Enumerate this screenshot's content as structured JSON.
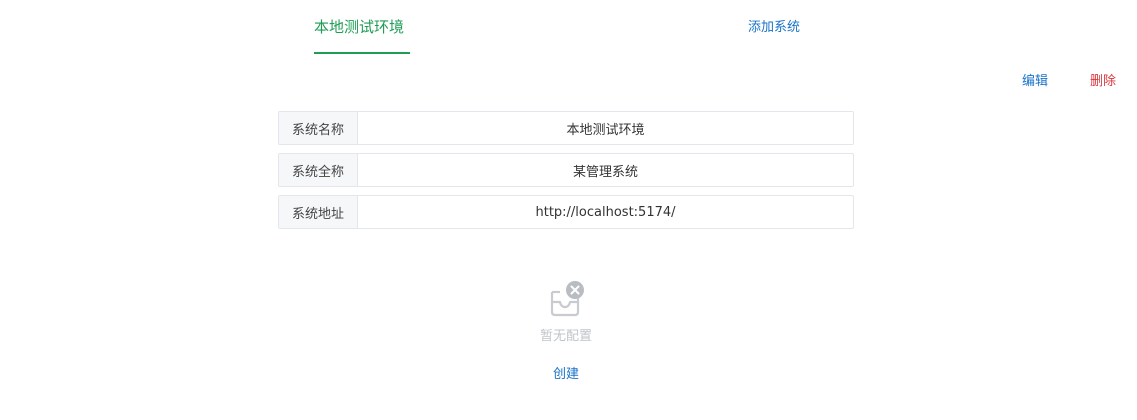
{
  "tabs": {
    "active_label": "本地测试环境",
    "add_label": "添加系统"
  },
  "actions": {
    "edit_label": "编辑",
    "delete_label": "删除"
  },
  "details": [
    {
      "label": "系统名称",
      "value": "本地测试环境"
    },
    {
      "label": "系统全称",
      "value": "某管理系统"
    },
    {
      "label": "系统地址",
      "value": "http://localhost:5174/"
    }
  ],
  "empty_state": {
    "icon": "empty-inbox-icon",
    "text": "暂无配置",
    "create_label": "创建"
  },
  "colors": {
    "accent_green": "#1f9d55",
    "link_blue": "#1a73c9",
    "danger_red": "#d9363e",
    "muted_gray": "#c0c4cc"
  }
}
